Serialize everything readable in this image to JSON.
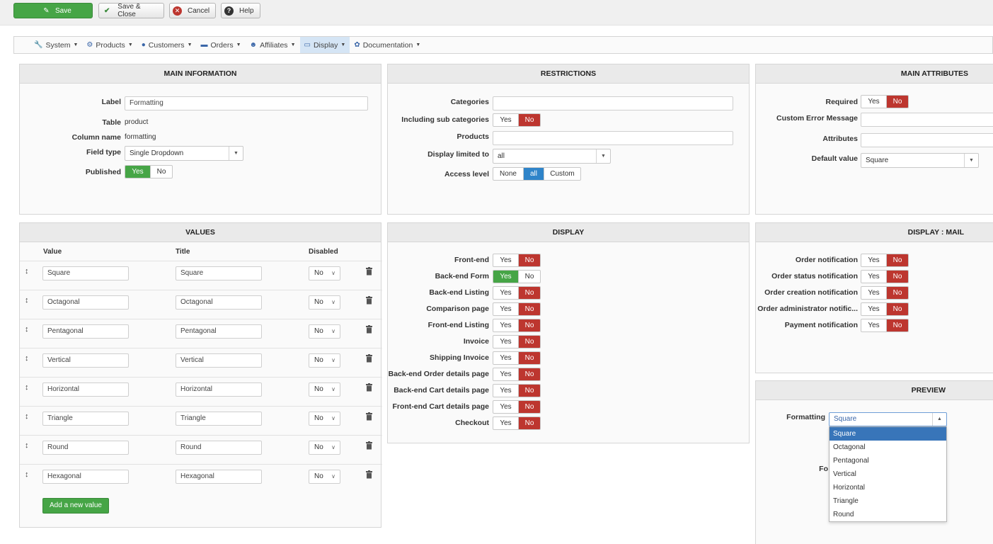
{
  "toolbar": {
    "save": "Save",
    "save_close": "Save & Close",
    "cancel": "Cancel",
    "help": "Help"
  },
  "menu": [
    {
      "label": "System",
      "icon": "wrench-icon",
      "active": false
    },
    {
      "label": "Products",
      "icon": "products-icon",
      "active": false
    },
    {
      "label": "Customers",
      "icon": "user-icon",
      "active": false
    },
    {
      "label": "Orders",
      "icon": "card-icon",
      "active": false
    },
    {
      "label": "Affiliates",
      "icon": "people-icon",
      "active": true
    },
    {
      "label": "Display",
      "icon": "monitor-icon",
      "active": true
    },
    {
      "label": "Documentation",
      "icon": "lifebuoy-icon",
      "active": false
    }
  ],
  "main_info": {
    "title": "MAIN INFORMATION",
    "label_label": "Label",
    "label_value": "Formatting",
    "table_label": "Table",
    "table_value": "product",
    "column_label": "Column name",
    "column_value": "formatting",
    "field_type_label": "Field type",
    "field_type_value": "Single Dropdown",
    "published_label": "Published",
    "yes": "Yes",
    "no": "No"
  },
  "restrictions": {
    "title": "RESTRICTIONS",
    "categories": "Categories",
    "including_sub": "Including sub categories",
    "products": "Products",
    "display_limited": "Display limited to",
    "display_limited_value": "all",
    "access_level": "Access level",
    "access_none": "None",
    "access_all": "all",
    "access_custom": "Custom",
    "yes": "Yes",
    "no": "No"
  },
  "main_attributes": {
    "title": "MAIN ATTRIBUTES",
    "required": "Required",
    "custom_error": "Custom Error Message",
    "attributes": "Attributes",
    "default_value": "Default value",
    "default_value_value": "Square",
    "yes": "Yes",
    "no": "No"
  },
  "values": {
    "title": "VALUES",
    "col_value": "Value",
    "col_title": "Title",
    "col_disabled": "Disabled",
    "rows": [
      {
        "value": "Square",
        "title": "Square",
        "disabled": "No"
      },
      {
        "value": "Octagonal",
        "title": "Octagonal",
        "disabled": "No"
      },
      {
        "value": "Pentagonal",
        "title": "Pentagonal",
        "disabled": "No"
      },
      {
        "value": "Vertical",
        "title": "Vertical",
        "disabled": "No"
      },
      {
        "value": "Horizontal",
        "title": "Horizontal",
        "disabled": "No"
      },
      {
        "value": "Triangle",
        "title": "Triangle",
        "disabled": "No"
      },
      {
        "value": "Round",
        "title": "Round",
        "disabled": "No"
      },
      {
        "value": "Hexagonal",
        "title": "Hexagonal",
        "disabled": "No"
      }
    ],
    "add_button": "Add a new value"
  },
  "display": {
    "title": "DISPLAY",
    "yes": "Yes",
    "no": "No",
    "rows": [
      {
        "label": "Front-end",
        "value": "No"
      },
      {
        "label": "Back-end Form",
        "value": "Yes"
      },
      {
        "label": "Back-end Listing",
        "value": "No"
      },
      {
        "label": "Comparison page",
        "value": "No"
      },
      {
        "label": "Front-end Listing",
        "value": "No"
      },
      {
        "label": "Invoice",
        "value": "No"
      },
      {
        "label": "Shipping Invoice",
        "value": "No"
      },
      {
        "label": "Back-end Order details page",
        "value": "No"
      },
      {
        "label": "Back-end Cart details page",
        "value": "No"
      },
      {
        "label": "Front-end Cart details page",
        "value": "No"
      },
      {
        "label": "Checkout",
        "value": "No"
      }
    ]
  },
  "display_mail": {
    "title": "DISPLAY : MAIL",
    "yes": "Yes",
    "no": "No",
    "rows": [
      {
        "label": "Order notification",
        "value": "No"
      },
      {
        "label": "Order status notification",
        "value": "No"
      },
      {
        "label": "Order creation notification",
        "value": "No"
      },
      {
        "label": "Order administrator notific...",
        "value": "No"
      },
      {
        "label": "Payment notification",
        "value": "No"
      }
    ]
  },
  "preview": {
    "title": "PREVIEW",
    "field_label": "Formatting",
    "selected": "Square",
    "partial_label": "Fo",
    "options": [
      "Square",
      "Octagonal",
      "Pentagonal",
      "Vertical",
      "Horizontal",
      "Triangle",
      "Round"
    ]
  }
}
